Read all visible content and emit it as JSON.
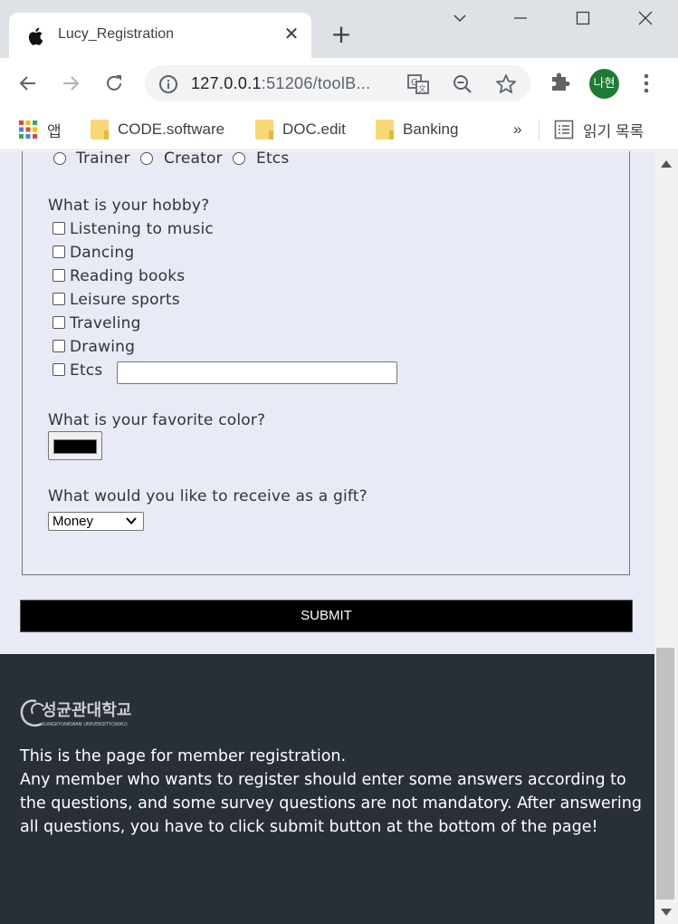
{
  "browser": {
    "tab_title": "Lucy_Registration",
    "url_host": "127.0.0.1",
    "url_rest": ":51206/toolB...",
    "profile_initials": "나현",
    "bookmarks": {
      "apps_label": "앱",
      "items": [
        "CODE.software",
        "DOC.edit",
        "Banking"
      ],
      "overflow": "»",
      "reading_list": "읽기 목록"
    }
  },
  "form": {
    "job_options": [
      "Trainer",
      "Creator",
      "Etcs"
    ],
    "hobby_question": "What is your hobby?",
    "hobbies": [
      "Listening to music",
      "Dancing",
      "Reading books",
      "Leisure sports",
      "Traveling",
      "Drawing",
      "Etcs"
    ],
    "color_question": "What is your favorite color?",
    "color_value": "#000000",
    "gift_question": "What would you like to receive as a gift?",
    "gift_selected": "Money",
    "submit_label": "SUBMIT"
  },
  "footer": {
    "logo_text": "성균관대학교",
    "logo_subtext": "SUNGKYUNKWAN UNIVERSITY(SKKU)",
    "line1": "This is the page for member registration.",
    "line2": "Any member who wants to register should enter some answers according to the questions, and some survey questions are not mandatory. After answering all questions, you have to click submit button at the bottom of the page!"
  }
}
